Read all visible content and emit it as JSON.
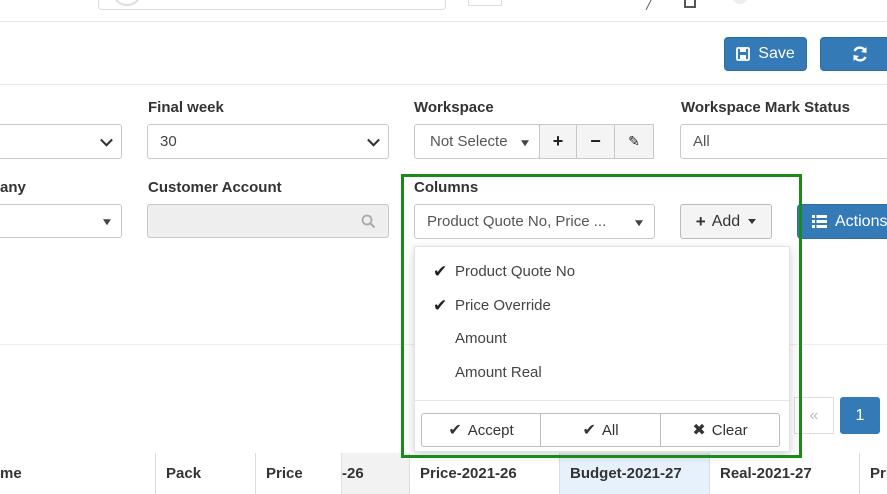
{
  "header": {
    "save_label": "Save"
  },
  "filters": {
    "final_week_label": "Final week",
    "final_week_value": "30",
    "workspace_label": "Workspace",
    "workspace_value": "Not Selecte",
    "workspace_mark_status_label": "Workspace Mark Status",
    "workspace_mark_status_value": "All",
    "company_label_partial": "any",
    "customer_account_label": "Customer Account",
    "columns_label": "Columns",
    "columns_value": "Product Quote No, Price ...",
    "add_label": "Add",
    "actions_label": "Actions"
  },
  "columns_dropdown": {
    "items": [
      {
        "label": "Product Quote No",
        "checked": true
      },
      {
        "label": "Price Override",
        "checked": true
      },
      {
        "label": "Amount",
        "checked": false
      },
      {
        "label": "Amount Real",
        "checked": false
      }
    ],
    "accept_label": "Accept",
    "all_label": "All",
    "clear_label": "Clear"
  },
  "pagination": {
    "prev_symbol": "«",
    "current_page": "1"
  },
  "table": {
    "headers": [
      "me",
      "Pack",
      "Price",
      "-26",
      "Price-2021-26",
      "Budget-2021-27",
      "Real-2021-27",
      "Pri"
    ]
  },
  "colors": {
    "primary": "#337ab7",
    "highlight_border": "#1a8a1a",
    "highlight_header": "#e7f1fc"
  }
}
